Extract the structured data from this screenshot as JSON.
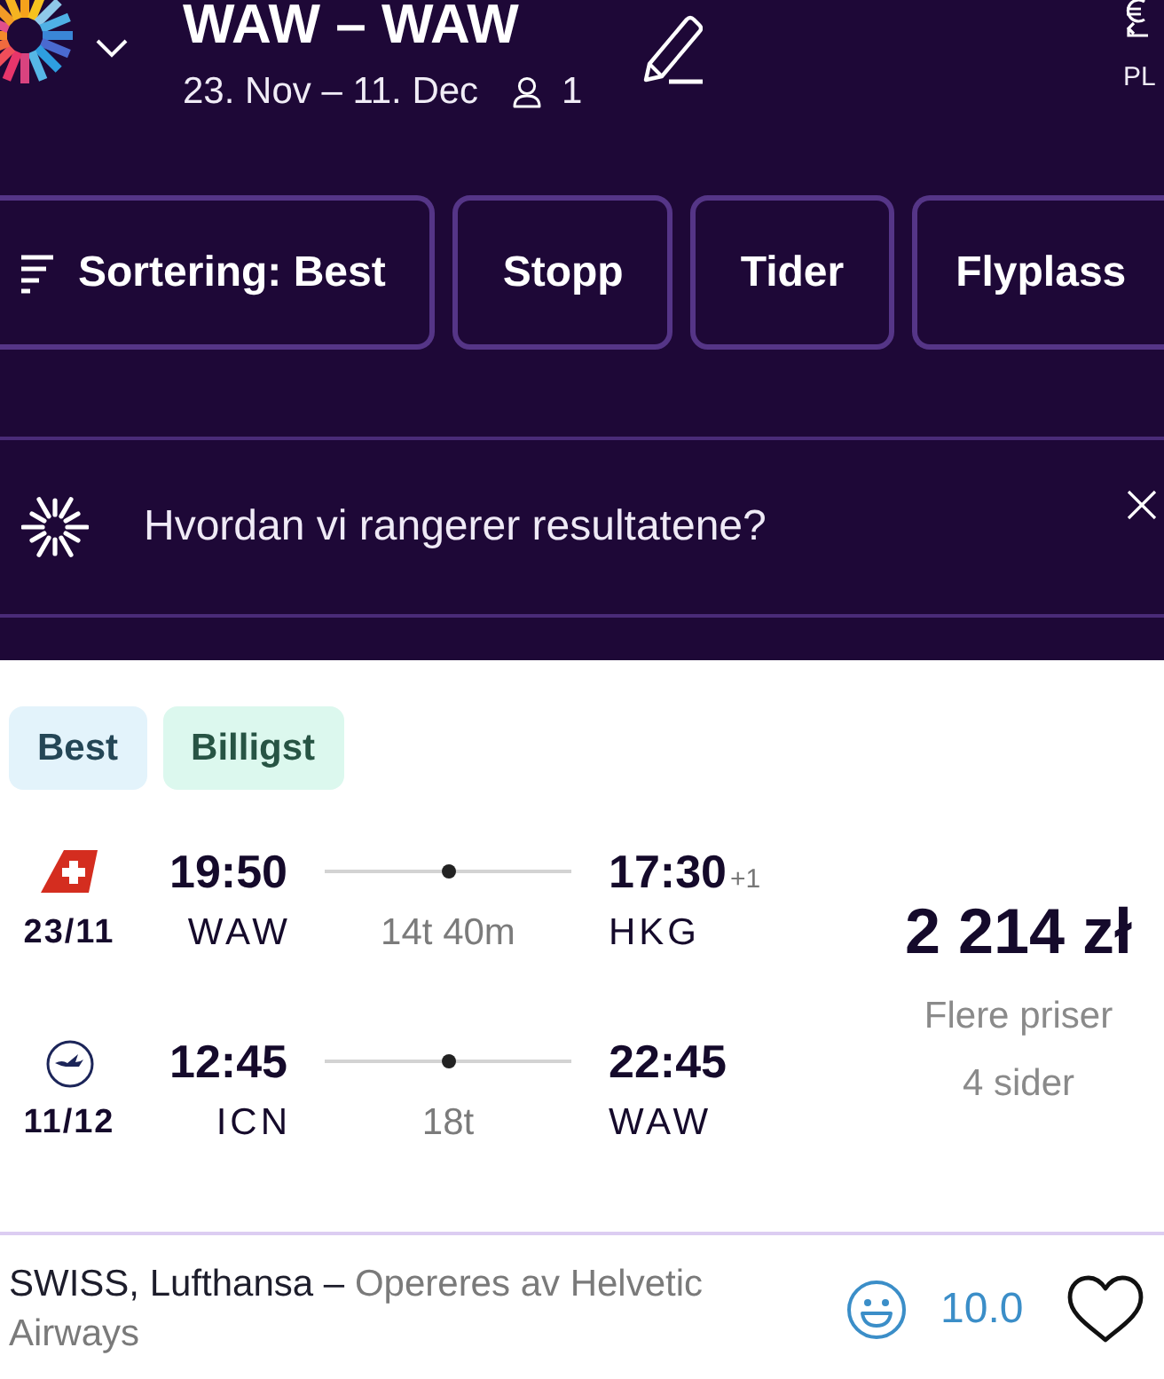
{
  "header": {
    "title": "WAW – WAW",
    "dates": "23. Nov – 11. Dec",
    "travelers": "1",
    "currency": "PL"
  },
  "filters": [
    {
      "kind": "sort",
      "label": "Sortering: Best"
    },
    {
      "kind": "filter",
      "label": "Stopp"
    },
    {
      "kind": "filter",
      "label": "Tider"
    },
    {
      "kind": "filter",
      "label": "Flyplass"
    }
  ],
  "info_banner": {
    "text": "Hvordan vi rangerer resultatene?"
  },
  "result": {
    "tags": [
      {
        "label": "Best",
        "color": "#e3f3fb"
      },
      {
        "label": "Billigst",
        "color": "#dcf8ee"
      }
    ],
    "legs": [
      {
        "kind": "tail-fin",
        "date": "23/11",
        "depart_time": "19:50",
        "depart_airport": "WAW",
        "duration": "14t 40m",
        "arrive_time": "17:30",
        "day_offset": "+1",
        "arrive_airport": "HKG"
      },
      {
        "kind": "roundel",
        "date": "11/12",
        "depart_time": "12:45",
        "depart_airport": "ICN",
        "duration": "18t",
        "arrive_time": "22:45",
        "arrive_airport": "WAW"
      }
    ],
    "price": "2 214 zł",
    "more_prices": "Flere priser",
    "providers": "4 sider",
    "airlines": "SWISS, Lufthansa –",
    "operator": "Opereres av Helvetic Airways",
    "score": "10.0",
    "favorite": false
  }
}
